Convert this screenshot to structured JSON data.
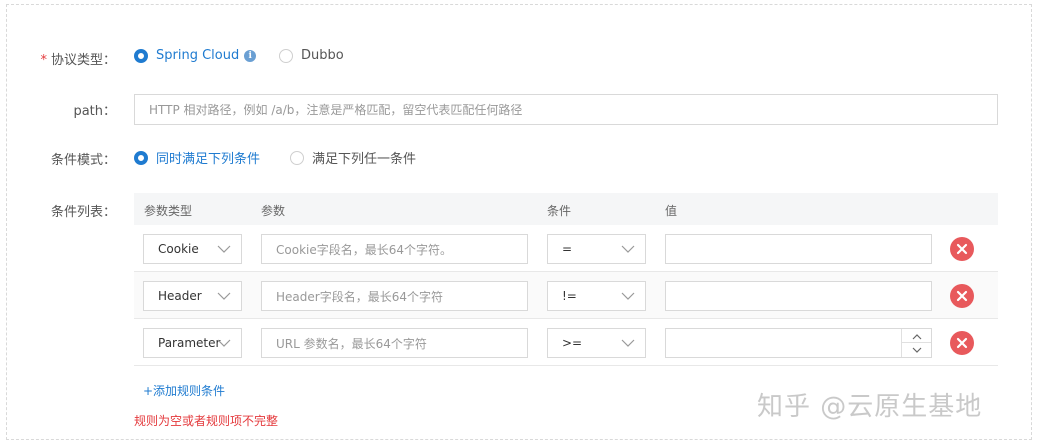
{
  "protocol": {
    "label": "协议类型：",
    "required_mark": "*",
    "options": [
      {
        "label": "Spring Cloud",
        "selected": true
      },
      {
        "label": "Dubbo",
        "selected": false
      }
    ],
    "info_glyph": "i"
  },
  "path": {
    "label": "path：",
    "placeholder": "HTTP 相对路径，例如 /a/b，注意是严格匹配，留空代表匹配任何路径"
  },
  "condition_mode": {
    "label": "条件模式：",
    "options": [
      {
        "label": "同时满足下列条件",
        "selected": true
      },
      {
        "label": "满足下列任一条件",
        "selected": false
      }
    ]
  },
  "condition_list": {
    "label": "条件列表：",
    "columns": [
      "参数类型",
      "参数",
      "条件",
      "值"
    ],
    "rows": [
      {
        "param_type": "Cookie",
        "param_placeholder": "Cookie字段名，最长64个字符。",
        "operator": "=",
        "value": ""
      },
      {
        "param_type": "Header",
        "param_placeholder": "Header字段名，最长64个字符",
        "operator": "!=",
        "value": ""
      },
      {
        "param_type": "Parameter",
        "param_placeholder": "URL 参数名，最长64个字符",
        "operator": ">=",
        "value": ""
      }
    ]
  },
  "add_rule_label": "+添加规则条件",
  "error_message": "规则为空或者规则项不完整",
  "watermark": "知乎 @云原生基地",
  "colors": {
    "accent": "#1f7bd0",
    "danger": "#e8595c",
    "error_text": "#e4393c"
  }
}
